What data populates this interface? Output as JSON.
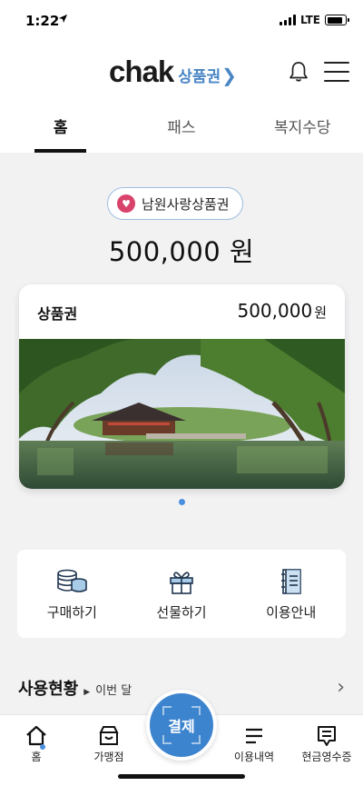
{
  "status": {
    "time": "1:22",
    "network": "LTE",
    "battery_level": 0.85
  },
  "header": {
    "logo_main": "chak",
    "logo_sub": "상품권",
    "logo_chevron": "❯",
    "bell_icon": "bell-icon",
    "menu_icon": "hamburger-menu-icon"
  },
  "tabs": [
    {
      "label": "홈",
      "active": true
    },
    {
      "label": "패스",
      "active": false
    },
    {
      "label": "복지수당",
      "active": false
    }
  ],
  "voucher": {
    "name": "남원사랑상품권",
    "balance": "500,000 원"
  },
  "card": {
    "title": "상품권",
    "amount": "500,000",
    "unit": "원"
  },
  "actions": [
    {
      "label": "구매하기",
      "icon": "coins-icon"
    },
    {
      "label": "선물하기",
      "icon": "gift-icon"
    },
    {
      "label": "이용안내",
      "icon": "guide-book-icon"
    }
  ],
  "usage": {
    "title": "사용현황",
    "arrow": "▶",
    "period": "이번 달",
    "more": "›"
  },
  "bottom_nav": {
    "home": "홈",
    "stores": "가맹점",
    "pay": "결제",
    "history": "이용내역",
    "receipt": "현금영수증"
  },
  "colors": {
    "accent": "#3d84cf",
    "brand_blue": "#4a86c5",
    "chip_border": "#9bbde0",
    "chip_icon": "#d9436b",
    "background": "#f2f2f3"
  }
}
